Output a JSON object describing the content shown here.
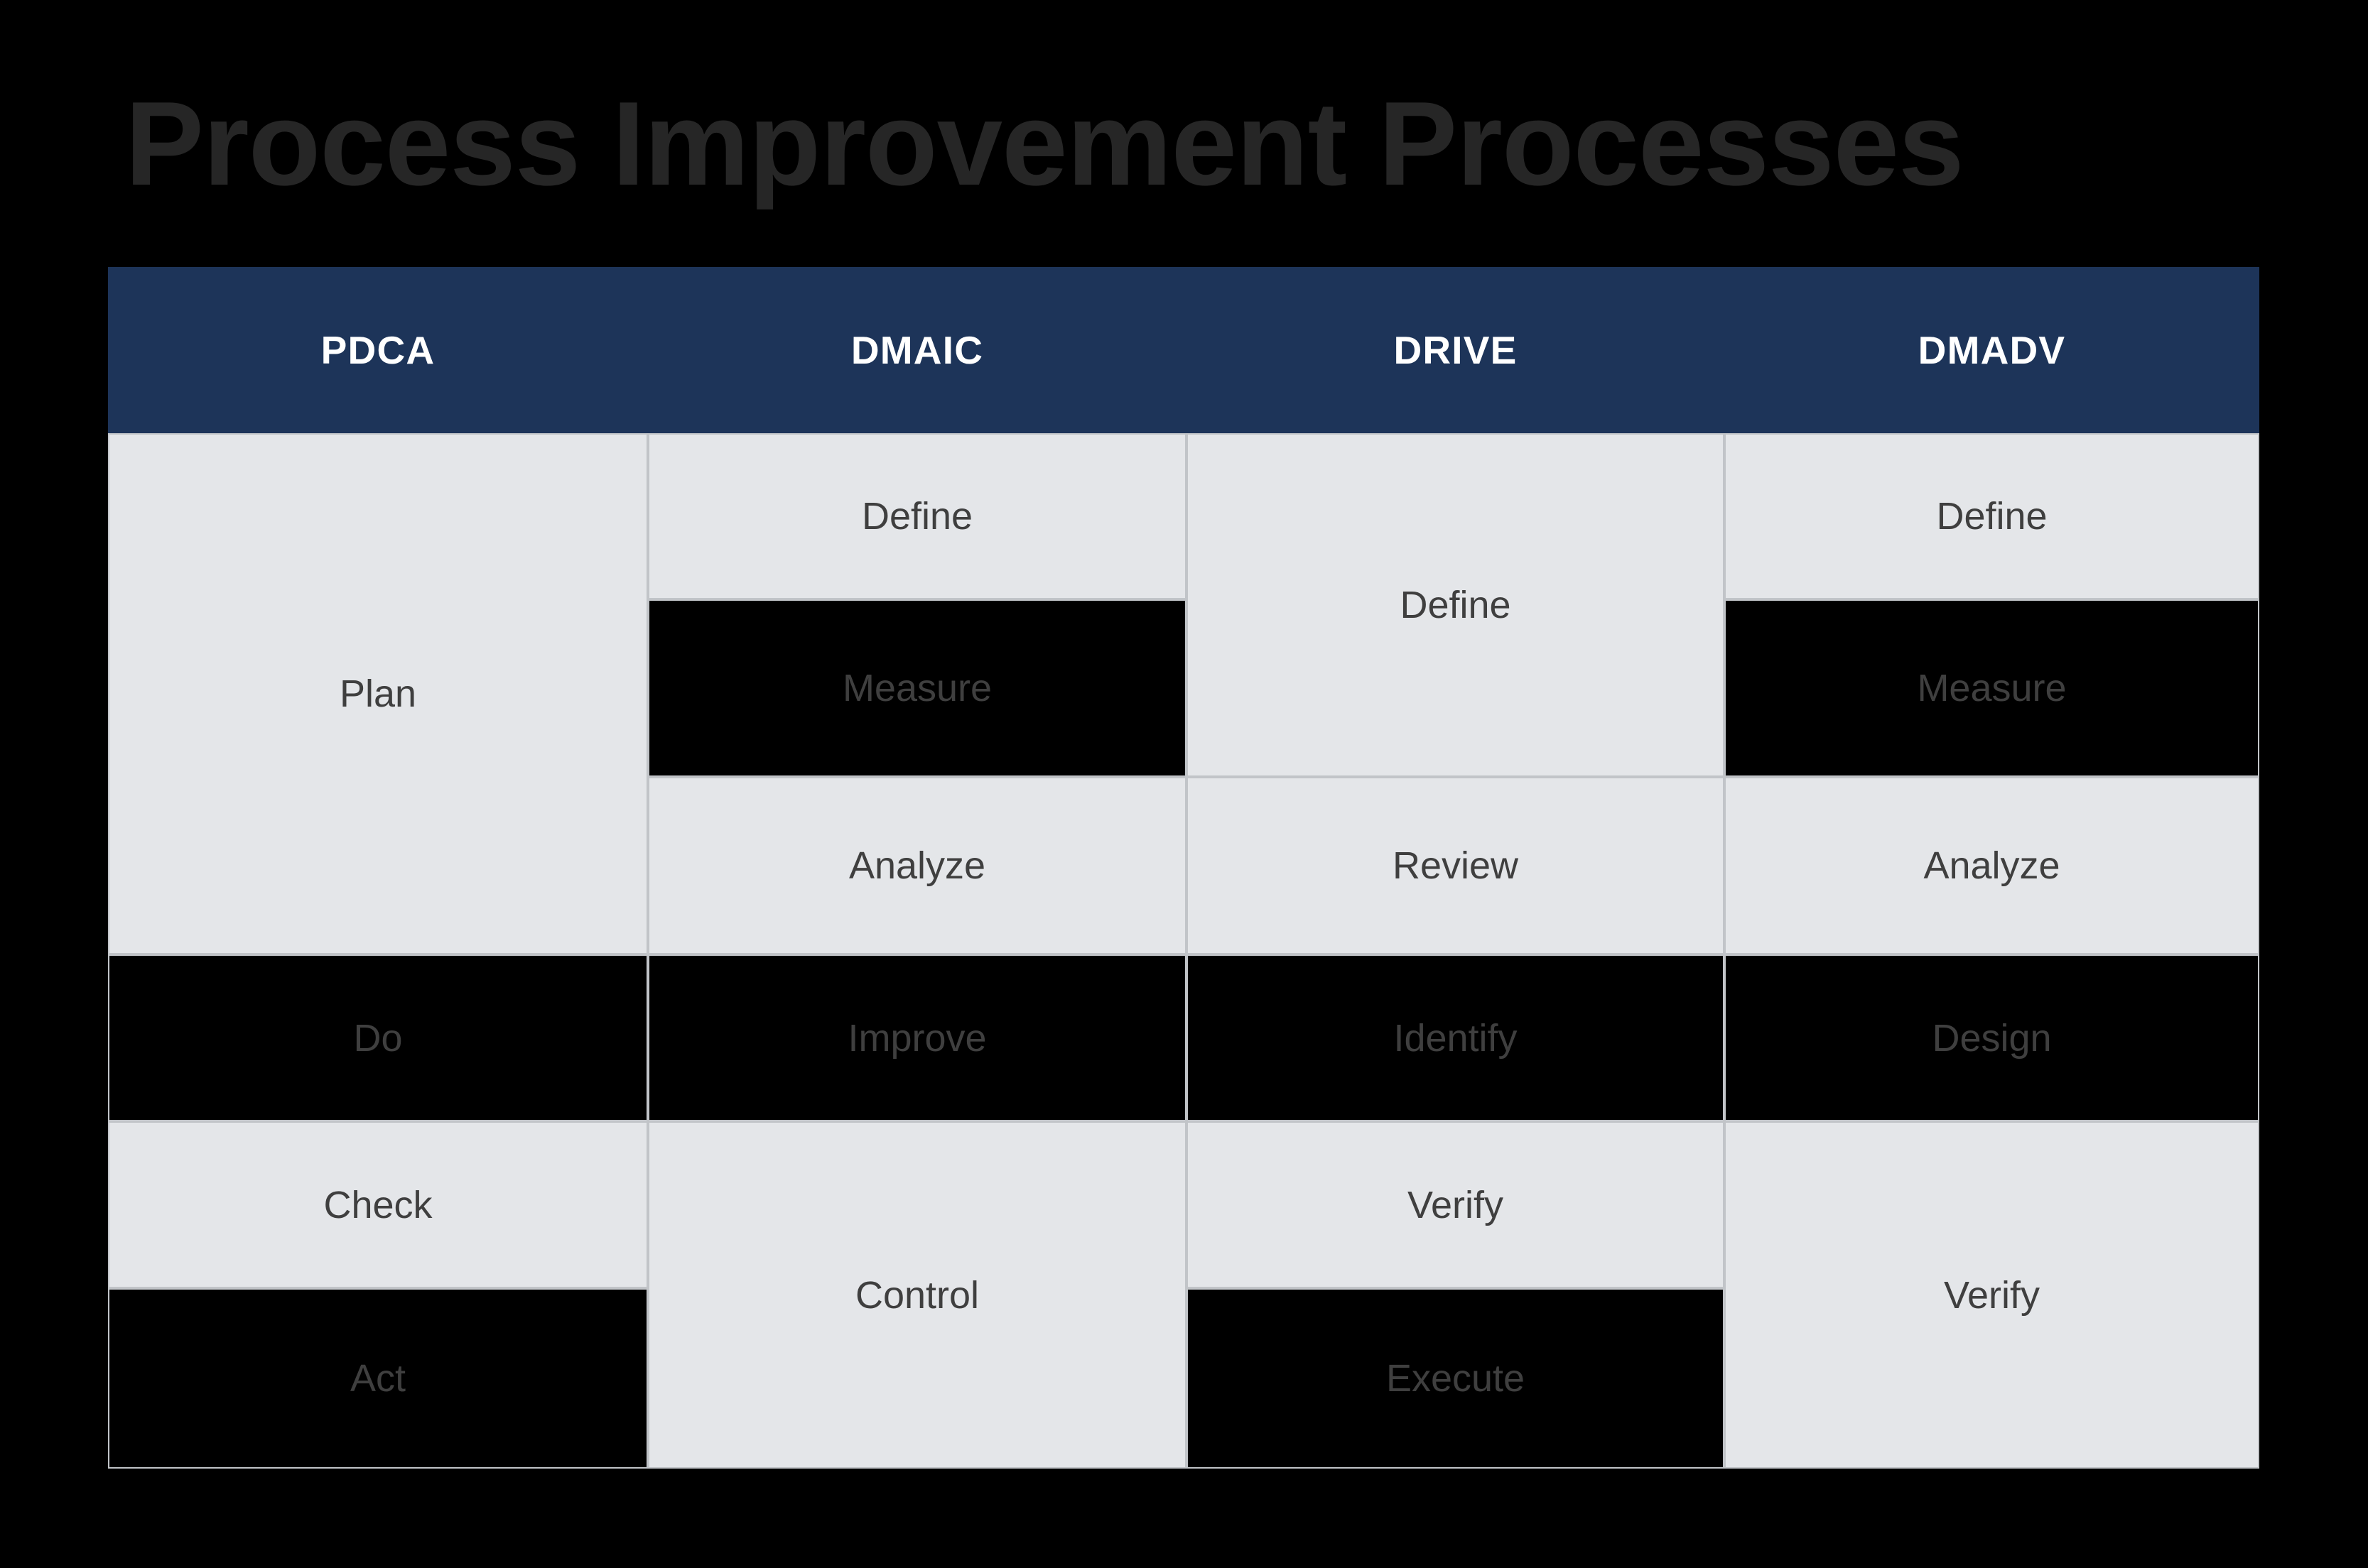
{
  "page": {
    "title": "Process Improvement Processes",
    "background_color": "#000000",
    "title_color": "#262626"
  },
  "table": {
    "header_background": "#1d3459",
    "header_text_color": "#ffffff",
    "cell_light_background": "#e4e6e9",
    "cell_dark_background": "#000000",
    "cell_text_color": "#3f3f3f",
    "border_color": "#c1c4c8",
    "columns": [
      {
        "key": "pdca",
        "label": "PDCA"
      },
      {
        "key": "dmaic",
        "label": "DMAIC"
      },
      {
        "key": "drive",
        "label": "DRIVE"
      },
      {
        "key": "dmadv",
        "label": "DMADV"
      }
    ],
    "cells": {
      "pdca_plan": {
        "label": "Plan",
        "shade": "light"
      },
      "pdca_do": {
        "label": "Do",
        "shade": "dark"
      },
      "pdca_check": {
        "label": "Check",
        "shade": "light"
      },
      "pdca_act": {
        "label": "Act",
        "shade": "dark"
      },
      "dmaic_define": {
        "label": "Define",
        "shade": "light"
      },
      "dmaic_measure": {
        "label": "Measure",
        "shade": "dark"
      },
      "dmaic_analyze": {
        "label": "Analyze",
        "shade": "light"
      },
      "dmaic_improve": {
        "label": "Improve",
        "shade": "dark"
      },
      "dmaic_control": {
        "label": "Control",
        "shade": "light"
      },
      "drive_define": {
        "label": "Define",
        "shade": "light"
      },
      "drive_review": {
        "label": "Review",
        "shade": "light"
      },
      "drive_identify": {
        "label": "Identify",
        "shade": "dark"
      },
      "drive_verify": {
        "label": "Verify",
        "shade": "light"
      },
      "drive_execute": {
        "label": "Execute",
        "shade": "dark"
      },
      "dmadv_define": {
        "label": "Define",
        "shade": "light"
      },
      "dmadv_measure": {
        "label": "Measure",
        "shade": "dark"
      },
      "dmadv_analyze": {
        "label": "Analyze",
        "shade": "light"
      },
      "dmadv_design": {
        "label": "Design",
        "shade": "dark"
      },
      "dmadv_verify": {
        "label": "Verify",
        "shade": "light"
      }
    }
  }
}
